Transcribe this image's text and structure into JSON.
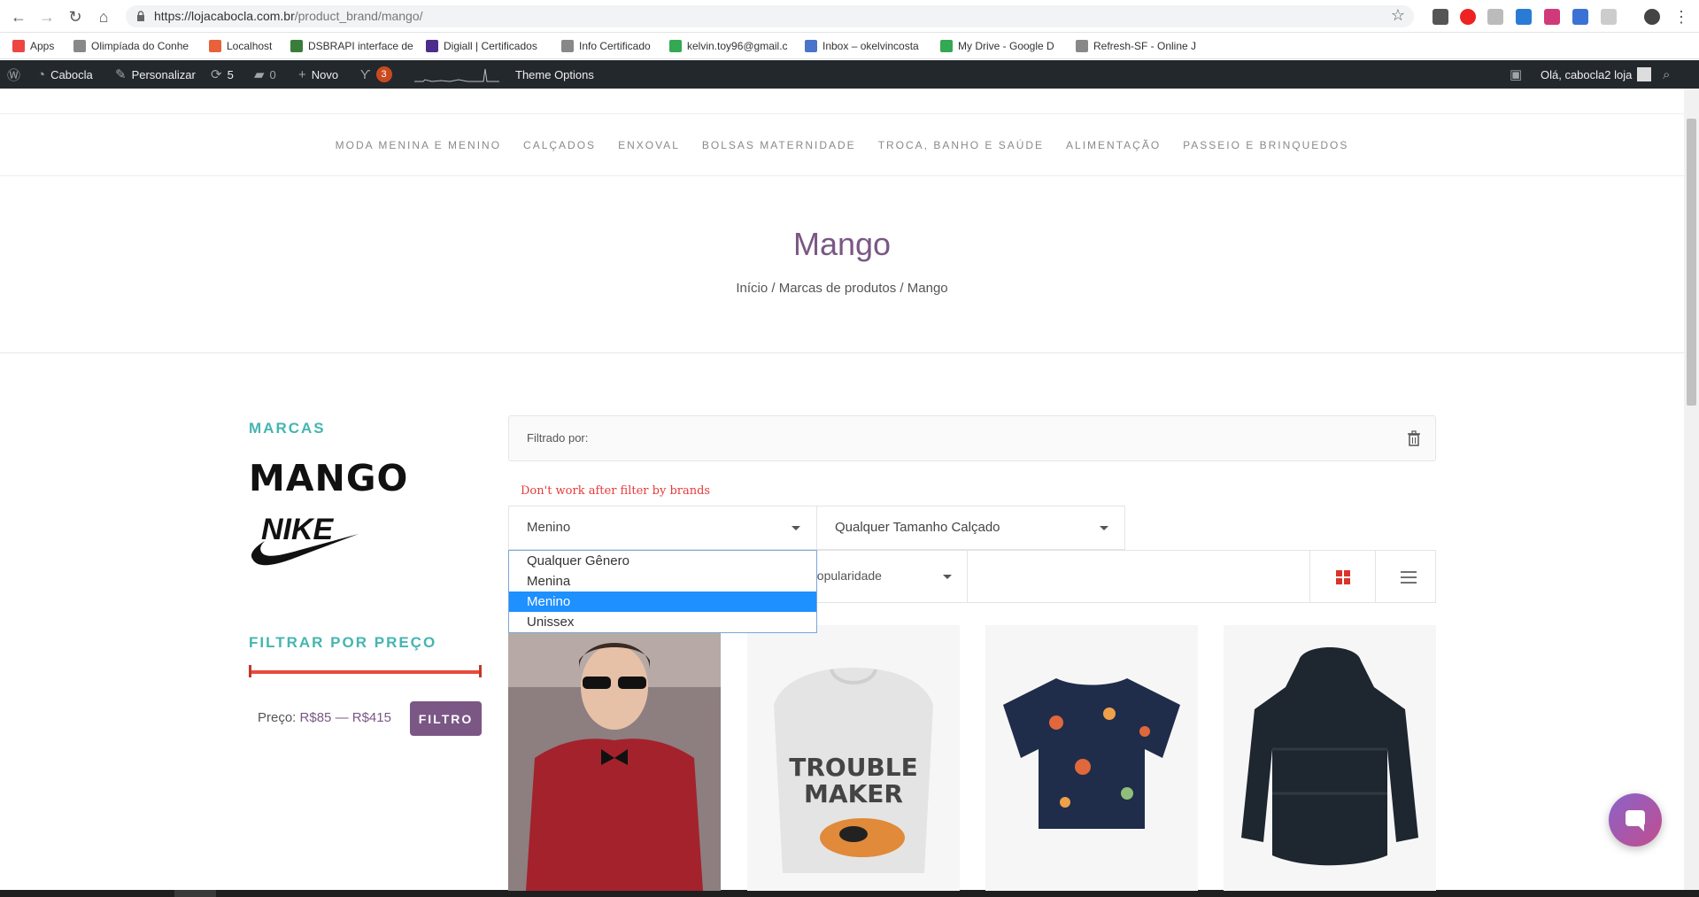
{
  "browser": {
    "url_host": "https://lojacabocla.com.br",
    "url_path": "/product_brand/mango/"
  },
  "bookmarks": [
    {
      "label": "Apps",
      "color": "#e44"
    },
    {
      "label": "Olimpíada do Conhe",
      "color": "#888"
    },
    {
      "label": "Localhost",
      "color": "#e8613a"
    },
    {
      "label": "DSBRAPI interface de",
      "color": "#3a7d3a"
    },
    {
      "label": "Digiall | Certificados",
      "color": "#4a2e8a"
    },
    {
      "label": "Info Certificado",
      "color": "#888"
    },
    {
      "label": "kelvin.toy96@gmail.c",
      "color": "#34a853"
    },
    {
      "label": "Inbox – okelvincosta",
      "color": "#4a74c9"
    },
    {
      "label": "My Drive - Google D",
      "color": "#34a853"
    },
    {
      "label": "Refresh-SF - Online J",
      "color": "#888"
    }
  ],
  "adminbar": {
    "site": "Cabocla",
    "customize": "Personalizar",
    "updates": "5",
    "comments": "0",
    "new": "Novo",
    "yoast_count": "3",
    "theme_options": "Theme Options",
    "greeting": "Olá, cabocla2 loja"
  },
  "nav": [
    "MODA MENINA E MENINO",
    "CALÇADOS",
    "ENXOVAL",
    "BOLSAS MATERNIDADE",
    "TROCA, BANHO E SAÚDE",
    "ALIMENTAÇÃO",
    "PASSEIO E BRINQUEDOS"
  ],
  "hero": {
    "title": "Mango",
    "breadcrumb": "Início / Marcas de produtos / Mango"
  },
  "sidebar": {
    "brands_title": "MARCAS",
    "brand_1": "MANGO",
    "brand_2": "NIKE",
    "price_title": "FILTRAR POR PREÇO",
    "price_prefix": "Preço:",
    "price_min": "R$85",
    "price_sep": "—",
    "price_max": "R$415",
    "filter_button": "FILTRO"
  },
  "content": {
    "filtered_by": "Filtrado por:",
    "note": "Don't work after filter by brands",
    "gender_select": "Menino",
    "size_select": "Qualquer Tamanho Calçado",
    "sort_select": "popularidade",
    "gender_options": [
      "Qualquer Gênero",
      "Menina",
      "Menino",
      "Unissex"
    ],
    "gender_selected_index": 2
  },
  "colors": {
    "accent_teal": "#45b5b0",
    "brand_purple": "#7b5785",
    "adminbar": "#23282d"
  }
}
